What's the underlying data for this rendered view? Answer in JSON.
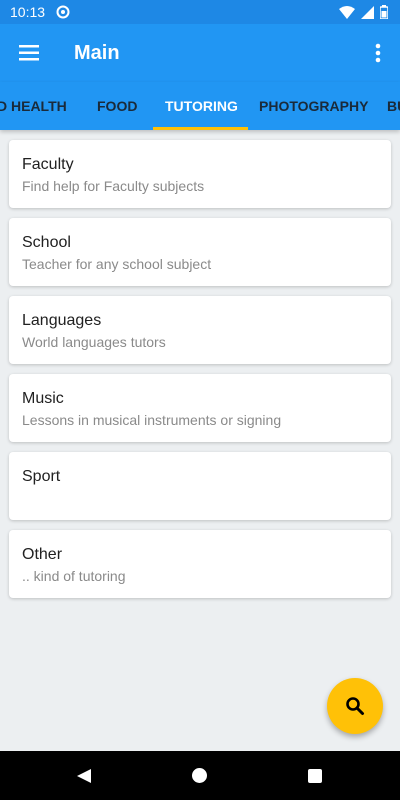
{
  "status_bar": {
    "time": "10:13",
    "icons": [
      "sync-icon",
      "wifi-icon",
      "signal-icon",
      "battery-icon"
    ]
  },
  "app_bar": {
    "title": "Main",
    "menu_icon": "hamburger-menu-icon",
    "more_icon": "more-vert-icon"
  },
  "tabs": [
    {
      "label": "D HEALTH"
    },
    {
      "label": "FOOD"
    },
    {
      "label": "TUTORING",
      "active": true
    },
    {
      "label": "PHOTOGRAPHY"
    },
    {
      "label": "BU"
    }
  ],
  "cards": [
    {
      "title": "Faculty",
      "subtitle": "Find help for Faculty subjects"
    },
    {
      "title": "School",
      "subtitle": "Teacher for any school subject"
    },
    {
      "title": "Languages",
      "subtitle": "World languages tutors"
    },
    {
      "title": "Music",
      "subtitle": "Lessons in musical instruments or signing"
    },
    {
      "title": "Sport",
      "subtitle": ""
    },
    {
      "title": "Other",
      "subtitle": ".. kind of tutoring"
    }
  ],
  "fab": {
    "icon": "search-icon"
  },
  "colors": {
    "primary": "#2196f3",
    "status_bar": "#1e88e5",
    "accent": "#ffc107",
    "background": "#eceff1"
  }
}
